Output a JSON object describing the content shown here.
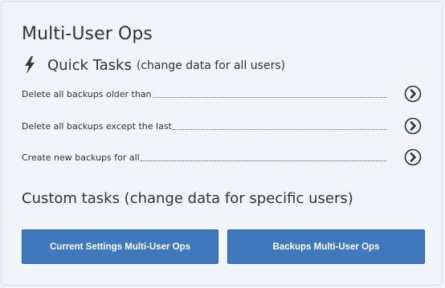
{
  "panel": {
    "title": "Multi-User Ops"
  },
  "quick_tasks": {
    "icon": "lightning-bolt-icon",
    "title": "Quick Tasks",
    "subtitle": "(change data for all users)",
    "items": [
      {
        "label": "Delete all backups older than",
        "icon": "circle-chevron-right-icon"
      },
      {
        "label": "Delete all backups except the last",
        "icon": "circle-chevron-right-icon"
      },
      {
        "label": "Create new backups for all",
        "icon": "circle-chevron-right-icon"
      }
    ]
  },
  "custom_tasks": {
    "title": "Custom tasks (change data for specific users)",
    "buttons": [
      {
        "label": "Current Settings Multi-User Ops"
      },
      {
        "label": "Backups Multi-User Ops"
      }
    ]
  },
  "colors": {
    "background": "#f1f4f9",
    "button": "#3f78bd",
    "text": "#2f3338",
    "icon": "#1f2f45"
  }
}
